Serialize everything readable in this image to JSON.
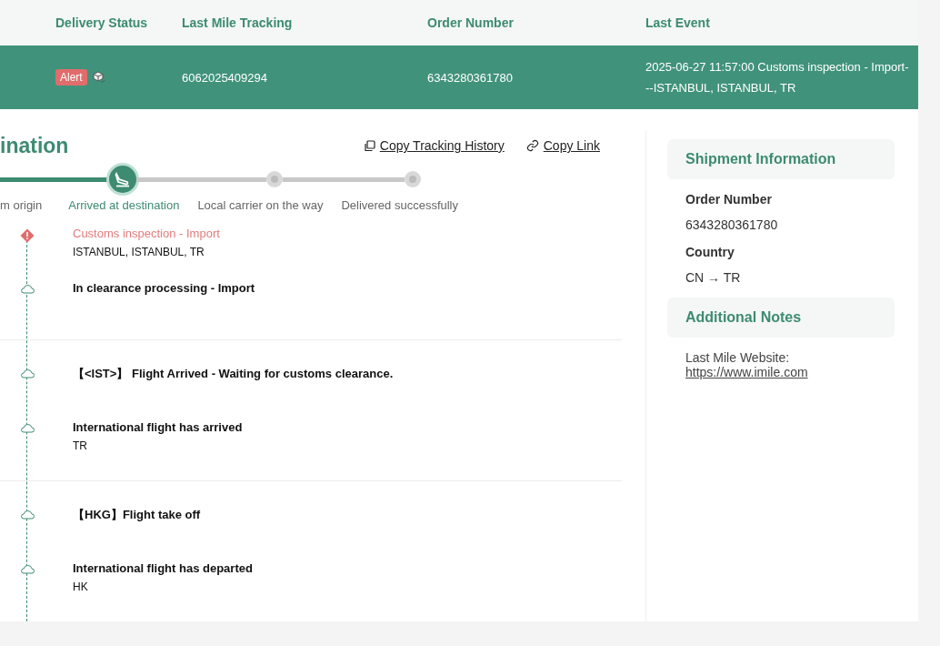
{
  "table": {
    "columns": [
      "Delivery Status",
      "Last Mile Tracking",
      "Order Number",
      "Last Event"
    ],
    "row": {
      "selected": true,
      "status_badge": "Alert",
      "last_mile_tracking": "6062025409294",
      "order_number": "6343280361780",
      "last_event": "2025-06-27 11:57:00 Customs inspection - Import---ISTANBUL, ISTANBUL, TR"
    }
  },
  "tracking": {
    "title": "ination",
    "actions": [
      {
        "label": "Copy Tracking History",
        "kind": "copy"
      },
      {
        "label": "Copy Link",
        "kind": "link"
      }
    ],
    "steps": [
      {
        "label": "m origin",
        "done": true,
        "selected": false
      },
      {
        "label": "Arrived at destination",
        "done": false,
        "selected": true
      },
      {
        "label": "Local carrier on the way",
        "done": false,
        "selected": false
      },
      {
        "label": "Delivered successfully",
        "done": false,
        "selected": false
      }
    ],
    "groups": [
      {
        "events": [
          {
            "kind": "alert",
            "title": "Customs inspection - Import",
            "location": "ISTANBUL, ISTANBUL, TR"
          },
          {
            "kind": "normal",
            "title": "In clearance processing - Import"
          }
        ]
      },
      {
        "events": [
          {
            "kind": "normal",
            "title": "【<IST>】 Flight Arrived - Waiting for customs clearance."
          },
          {
            "kind": "normal",
            "title": "International flight has arrived",
            "location": "TR"
          }
        ]
      },
      {
        "events": [
          {
            "kind": "normal",
            "title": "【HKG】Flight take off"
          },
          {
            "kind": "normal",
            "title": "International flight has departed",
            "location": "HK"
          }
        ]
      }
    ]
  },
  "sidebar": {
    "sections": [
      {
        "title": "Shipment Information",
        "fields": [
          {
            "label": "Order Number",
            "value": "6343280361780"
          },
          {
            "label": "Country",
            "value": "CN → TR"
          }
        ]
      },
      {
        "title": "Additional Notes",
        "note": "Last Mile Website:",
        "link": "https://www.imile.com"
      }
    ]
  }
}
